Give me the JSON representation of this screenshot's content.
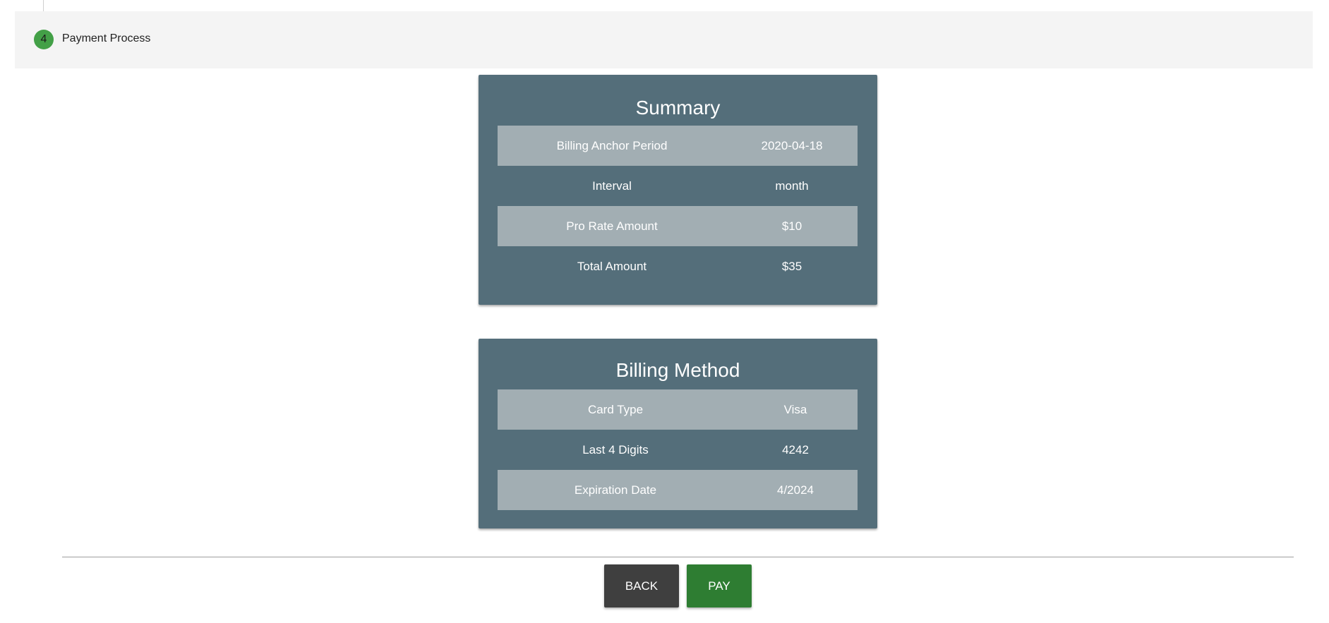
{
  "stepper": {
    "step_number": "4",
    "step_title": "Payment Process",
    "step_color": "#43a047"
  },
  "summary": {
    "title": "Summary",
    "rows": [
      {
        "label": "Billing Anchor Period",
        "value": "2020-04-18"
      },
      {
        "label": "Interval",
        "value": "month"
      },
      {
        "label": "Pro Rate Amount",
        "value": "$10"
      },
      {
        "label": "Total Amount",
        "value": "$35"
      }
    ]
  },
  "billing_method": {
    "title": "Billing Method",
    "rows": [
      {
        "label": "Card Type",
        "value": "Visa"
      },
      {
        "label": "Last 4 Digits",
        "value": "4242"
      },
      {
        "label": "Expiration Date",
        "value": "4/2024"
      }
    ]
  },
  "actions": {
    "back_label": "BACK",
    "pay_label": "PAY"
  },
  "colors": {
    "card_background": "#546e7a",
    "row_shade": "#a2aeb3",
    "back_button": "#3f3f3f",
    "pay_button": "#2e7d32"
  }
}
